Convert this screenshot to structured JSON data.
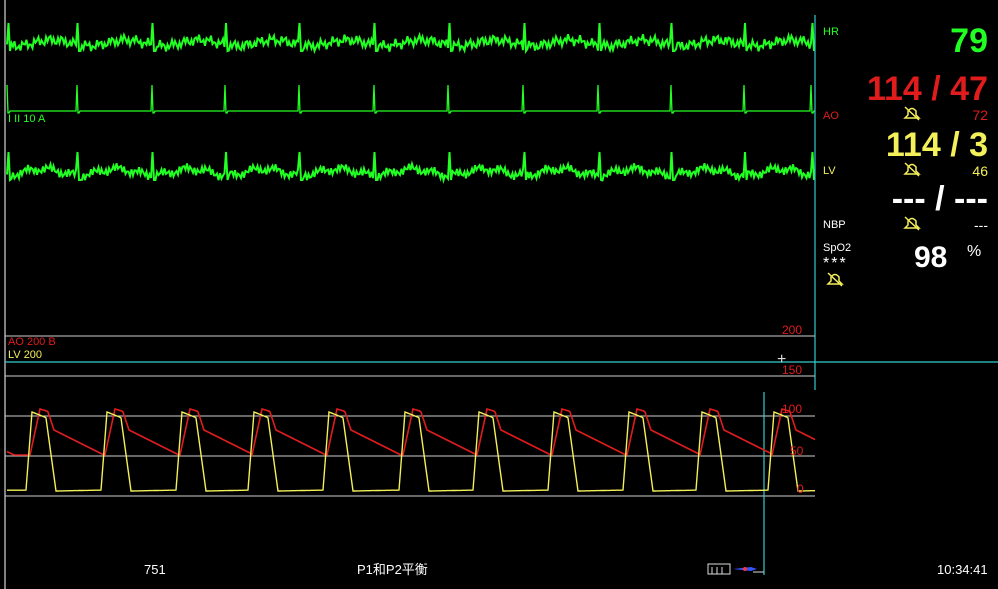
{
  "colors": {
    "ecg": "#22ff22",
    "ao": "#e01c1c",
    "lv": "#f4f05a",
    "white": "#ffffff",
    "cyan": "#33cccc",
    "gray": "#cfcfcf",
    "alarm_icon": "#f4f05a"
  },
  "ecg": {
    "lead1_label": "I II 10 A"
  },
  "pressure": {
    "ao_label": "AO  200  B",
    "lv_label": "LV  200",
    "scale_200": "200",
    "scale_150": "150",
    "scale_100": "100",
    "scale_50": "50",
    "scale_0": "0"
  },
  "params": {
    "hr": {
      "label": "HR",
      "value": "79"
    },
    "ao": {
      "label": "AO",
      "value": "114 / 47",
      "mean": "72"
    },
    "lv": {
      "label": "LV",
      "value": "114 / 3",
      "mean": "46"
    },
    "nbp": {
      "label": "NBP",
      "value": "--- / ---",
      "mean": "---"
    },
    "spo2": {
      "label": "SpO2",
      "value": "98",
      "unit": "%",
      "quality": "***"
    }
  },
  "status": {
    "left": "751",
    "center": "P1和P2平衡",
    "time": "10:34:41"
  },
  "icons": [
    "alarm-off-icon",
    "cursor-cross-icon",
    "printer-icon"
  ]
}
